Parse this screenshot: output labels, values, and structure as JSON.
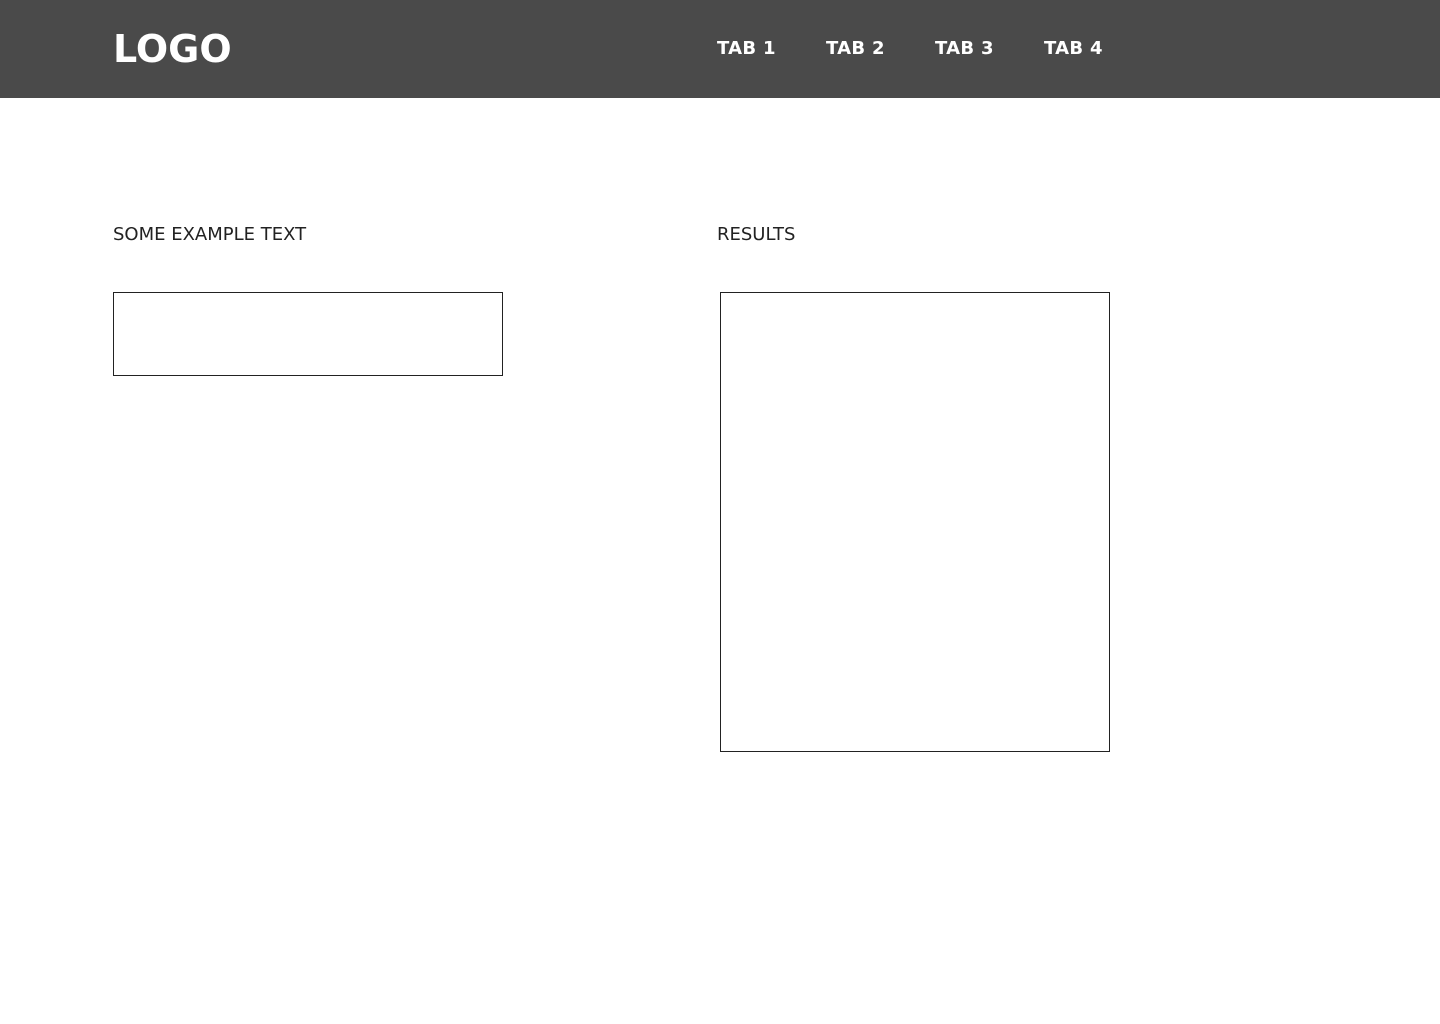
{
  "header": {
    "logo": "LOGO",
    "tabs": [
      {
        "label": "TAB 1"
      },
      {
        "label": "TAB 2"
      },
      {
        "label": "TAB 3"
      },
      {
        "label": "TAB 4"
      }
    ]
  },
  "main": {
    "left_label": "SOME EXAMPLE TEXT",
    "right_label": "RESULTS"
  },
  "colors": {
    "header_bg": "#4a4a4a",
    "header_text": "#ffffff",
    "body_text": "#222222",
    "border": "#222222"
  }
}
